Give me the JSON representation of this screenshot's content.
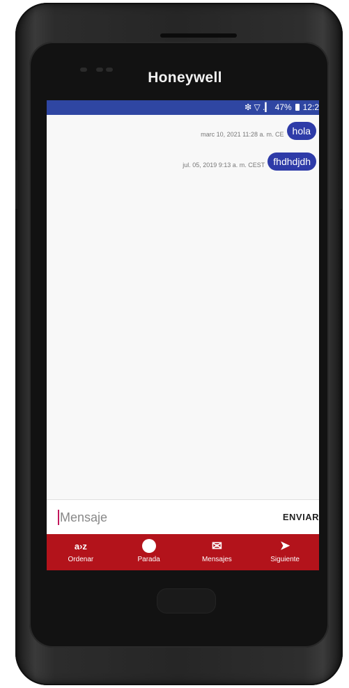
{
  "device": {
    "brand": "Honeywell"
  },
  "status_bar": {
    "signal_icons": "❇ ▽ .▎",
    "battery_percent": "47%",
    "time": "12:2"
  },
  "messages": [
    {
      "text": "hola",
      "timestamp": "marc 10, 2021 11:28 a. m. CE"
    },
    {
      "text": "fhdhdjdh",
      "timestamp": "jul. 05, 2019 9:13 a. m. CEST"
    }
  ],
  "composer": {
    "placeholder": "Mensaje",
    "send_label": "ENVIAR"
  },
  "bottom_nav": [
    {
      "label": "Ordenar",
      "icon": "a-z-sort-icon",
      "glyph": "a›z"
    },
    {
      "label": "Parada",
      "icon": "stop-circle-icon"
    },
    {
      "label": "Mensajes",
      "icon": "envelope-icon",
      "glyph": "✉"
    },
    {
      "label": "Siguiente",
      "icon": "send-arrow-icon",
      "glyph": "➤"
    }
  ],
  "colors": {
    "status_bar": "#2f46a2",
    "bubble": "#2e3ba8",
    "nav": "#b3131b",
    "cursor": "#c2185b"
  }
}
